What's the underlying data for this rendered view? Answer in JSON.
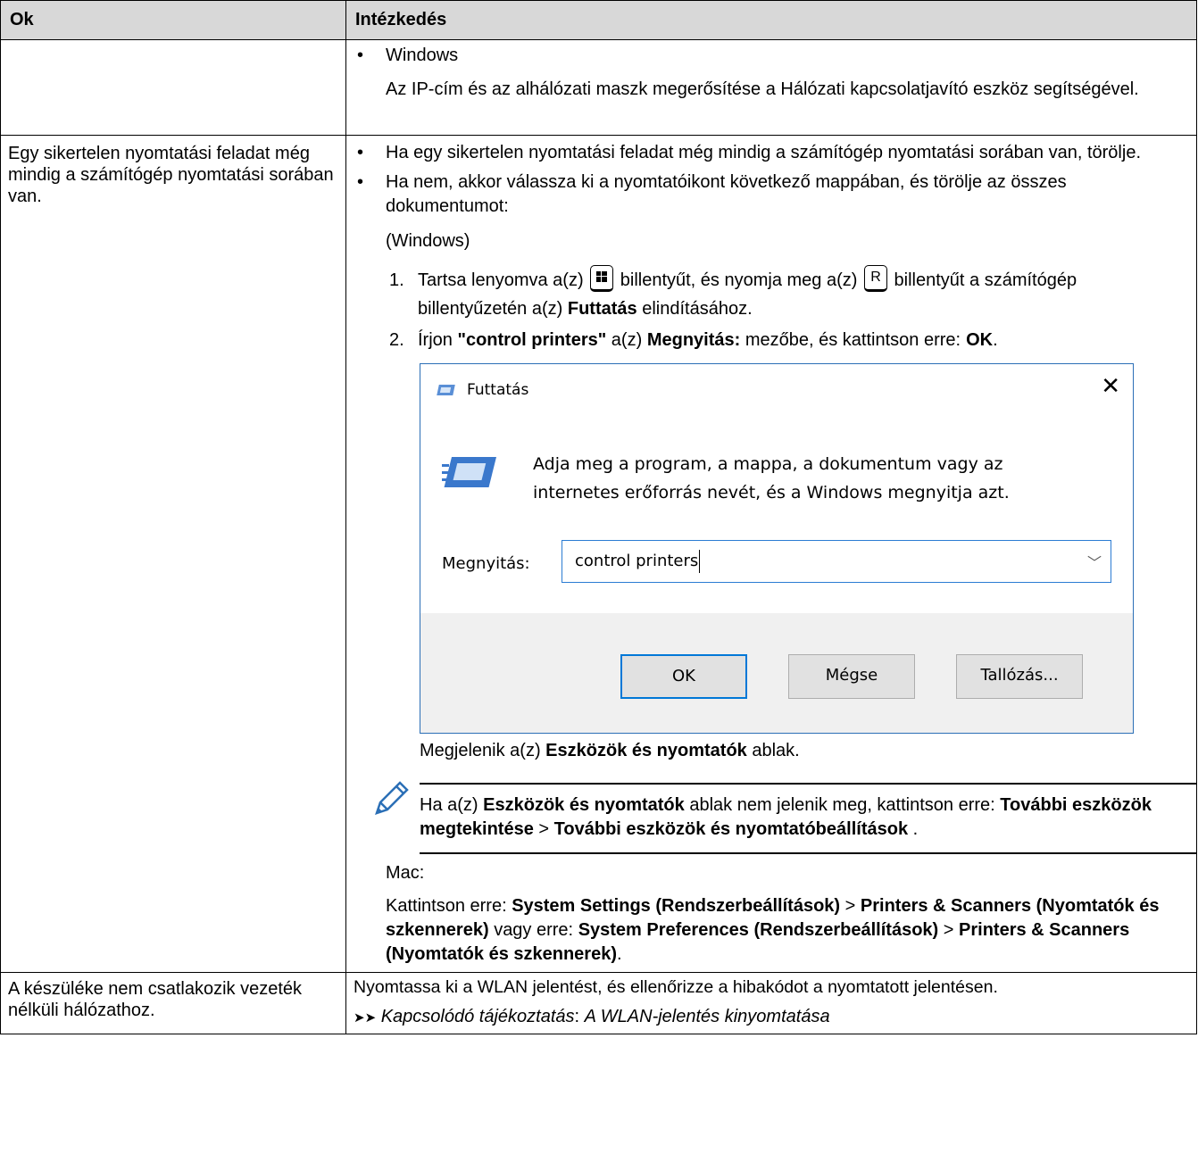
{
  "headers": {
    "reason": "Ok",
    "action": "Intézkedés"
  },
  "row1": {
    "bullet": "Windows",
    "text": "Az IP-cím és az alhálózati maszk megerősítése a Hálózati kapcsolatjavító eszköz segítségével."
  },
  "row2": {
    "cause": "Egy sikertelen nyomtatási feladat még mindig a számítógép nyomtatási sorában van.",
    "bullet1": "Ha egy sikertelen nyomtatási feladat még mindig a számítógép nyomtatási sorában van, törölje.",
    "bullet2": "Ha nem, akkor válassza ki a nyomtatóikont következő mappában, és törölje az összes dokumentumot:",
    "windows_label": "(Windows)",
    "step1": {
      "num": "1.",
      "a": "Tartsa lenyomva a(z)",
      "key1": "windows-key-icon",
      "b": "billentyűt, és nyomja meg a(z)",
      "key2": "R",
      "c": "billentyűt a számítógép billentyűzetén a(z)",
      "bold": "Futtatás",
      "d": "elindításához."
    },
    "step2": {
      "num": "2.",
      "a": "Írjon",
      "bold1": "\"control printers\"",
      "b": "a(z)",
      "bold2": "Megnyitás:",
      "c": "mezőbe, és kattintson erre:",
      "bold3": "OK",
      "d": "."
    },
    "dialog": {
      "title": "Futtatás",
      "message_line1": "Adja meg a program, a mappa, a dokumentum vagy az",
      "message_line2": "internetes erőforrás nevét, és a Windows megnyitja azt.",
      "open_label": "Megnyitás:",
      "input_value": "control printers",
      "ok": "OK",
      "cancel": "Mégse",
      "browse": "Tallózás..."
    },
    "after_dialog": {
      "a": "Megjelenik a(z)",
      "bold": "Eszközök és nyomtatók",
      "b": "ablak."
    },
    "note": {
      "a": "Ha a(z)",
      "bold1": "Eszközök és nyomtatók",
      "b": "ablak nem jelenik meg, kattintson erre:",
      "bold2": "További eszközök megtekintése",
      "sep": ">",
      "bold3": "További eszközök és nyomtatóbeállítások",
      "end": "."
    },
    "mac_label": "Mac:",
    "mac": {
      "a": "Kattintson erre:",
      "bold1": "System Settings (Rendszerbeállítások)",
      "sep1": ">",
      "bold2": "Printers & Scanners (Nyomtatók és szkennerek)",
      "b": "vagy erre:",
      "bold3": "System Preferences (Rendszerbeállítások)",
      "sep2": ">",
      "bold4": "Printers & Scanners (Nyomtatók és szkennerek)",
      "end": "."
    }
  },
  "row3": {
    "cause": "A készüléke nem csatlakozik vezeték nélküli hálózathoz.",
    "action": "Nyomtassa ki a WLAN jelentést, és ellenőrizze a hibakódot a nyomtatott jelentésen.",
    "link_prefix": "➤➤",
    "link_label": "Kapcsolódó tájékoztatás",
    "link_sep": ":",
    "link_text": "A WLAN-jelentés kinyomtatása"
  }
}
